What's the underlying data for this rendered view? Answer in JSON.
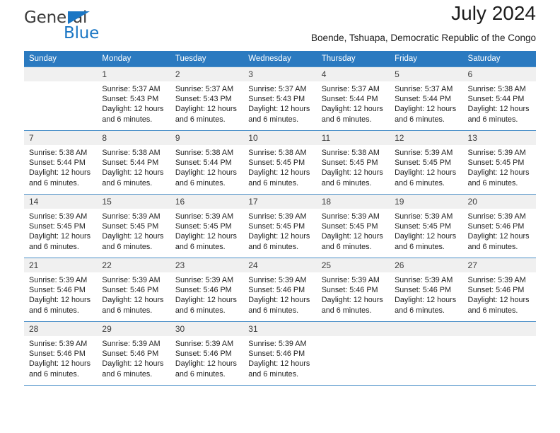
{
  "logo": {
    "primary_text": "General",
    "secondary_text": "Blue",
    "triangle_color": "#1a76c4",
    "primary_color": "#3b3b3b",
    "secondary_color": "#1a76c4"
  },
  "header": {
    "title": "July 2024",
    "subtitle": "Boende, Tshuapa, Democratic Republic of the Congo",
    "header_background": "#2b7ac0",
    "daynum_background": "#f0f0f0"
  },
  "weekday_headers": [
    "Sunday",
    "Monday",
    "Tuesday",
    "Wednesday",
    "Thursday",
    "Friday",
    "Saturday"
  ],
  "labels": {
    "sunrise_prefix": "Sunrise:",
    "sunset_prefix": "Sunset:",
    "daylight_prefix": "Daylight:"
  },
  "weeks": [
    [
      {
        "day": "",
        "empty": true
      },
      {
        "day": "1",
        "sunrise": "Sunrise: 5:37 AM",
        "sunset": "Sunset: 5:43 PM",
        "daylight_line1": "Daylight: 12 hours",
        "daylight_line2": "and 6 minutes."
      },
      {
        "day": "2",
        "sunrise": "Sunrise: 5:37 AM",
        "sunset": "Sunset: 5:43 PM",
        "daylight_line1": "Daylight: 12 hours",
        "daylight_line2": "and 6 minutes."
      },
      {
        "day": "3",
        "sunrise": "Sunrise: 5:37 AM",
        "sunset": "Sunset: 5:43 PM",
        "daylight_line1": "Daylight: 12 hours",
        "daylight_line2": "and 6 minutes."
      },
      {
        "day": "4",
        "sunrise": "Sunrise: 5:37 AM",
        "sunset": "Sunset: 5:44 PM",
        "daylight_line1": "Daylight: 12 hours",
        "daylight_line2": "and 6 minutes."
      },
      {
        "day": "5",
        "sunrise": "Sunrise: 5:37 AM",
        "sunset": "Sunset: 5:44 PM",
        "daylight_line1": "Daylight: 12 hours",
        "daylight_line2": "and 6 minutes."
      },
      {
        "day": "6",
        "sunrise": "Sunrise: 5:38 AM",
        "sunset": "Sunset: 5:44 PM",
        "daylight_line1": "Daylight: 12 hours",
        "daylight_line2": "and 6 minutes."
      }
    ],
    [
      {
        "day": "7",
        "sunrise": "Sunrise: 5:38 AM",
        "sunset": "Sunset: 5:44 PM",
        "daylight_line1": "Daylight: 12 hours",
        "daylight_line2": "and 6 minutes."
      },
      {
        "day": "8",
        "sunrise": "Sunrise: 5:38 AM",
        "sunset": "Sunset: 5:44 PM",
        "daylight_line1": "Daylight: 12 hours",
        "daylight_line2": "and 6 minutes."
      },
      {
        "day": "9",
        "sunrise": "Sunrise: 5:38 AM",
        "sunset": "Sunset: 5:44 PM",
        "daylight_line1": "Daylight: 12 hours",
        "daylight_line2": "and 6 minutes."
      },
      {
        "day": "10",
        "sunrise": "Sunrise: 5:38 AM",
        "sunset": "Sunset: 5:45 PM",
        "daylight_line1": "Daylight: 12 hours",
        "daylight_line2": "and 6 minutes."
      },
      {
        "day": "11",
        "sunrise": "Sunrise: 5:38 AM",
        "sunset": "Sunset: 5:45 PM",
        "daylight_line1": "Daylight: 12 hours",
        "daylight_line2": "and 6 minutes."
      },
      {
        "day": "12",
        "sunrise": "Sunrise: 5:39 AM",
        "sunset": "Sunset: 5:45 PM",
        "daylight_line1": "Daylight: 12 hours",
        "daylight_line2": "and 6 minutes."
      },
      {
        "day": "13",
        "sunrise": "Sunrise: 5:39 AM",
        "sunset": "Sunset: 5:45 PM",
        "daylight_line1": "Daylight: 12 hours",
        "daylight_line2": "and 6 minutes."
      }
    ],
    [
      {
        "day": "14",
        "sunrise": "Sunrise: 5:39 AM",
        "sunset": "Sunset: 5:45 PM",
        "daylight_line1": "Daylight: 12 hours",
        "daylight_line2": "and 6 minutes."
      },
      {
        "day": "15",
        "sunrise": "Sunrise: 5:39 AM",
        "sunset": "Sunset: 5:45 PM",
        "daylight_line1": "Daylight: 12 hours",
        "daylight_line2": "and 6 minutes."
      },
      {
        "day": "16",
        "sunrise": "Sunrise: 5:39 AM",
        "sunset": "Sunset: 5:45 PM",
        "daylight_line1": "Daylight: 12 hours",
        "daylight_line2": "and 6 minutes."
      },
      {
        "day": "17",
        "sunrise": "Sunrise: 5:39 AM",
        "sunset": "Sunset: 5:45 PM",
        "daylight_line1": "Daylight: 12 hours",
        "daylight_line2": "and 6 minutes."
      },
      {
        "day": "18",
        "sunrise": "Sunrise: 5:39 AM",
        "sunset": "Sunset: 5:45 PM",
        "daylight_line1": "Daylight: 12 hours",
        "daylight_line2": "and 6 minutes."
      },
      {
        "day": "19",
        "sunrise": "Sunrise: 5:39 AM",
        "sunset": "Sunset: 5:45 PM",
        "daylight_line1": "Daylight: 12 hours",
        "daylight_line2": "and 6 minutes."
      },
      {
        "day": "20",
        "sunrise": "Sunrise: 5:39 AM",
        "sunset": "Sunset: 5:46 PM",
        "daylight_line1": "Daylight: 12 hours",
        "daylight_line2": "and 6 minutes."
      }
    ],
    [
      {
        "day": "21",
        "sunrise": "Sunrise: 5:39 AM",
        "sunset": "Sunset: 5:46 PM",
        "daylight_line1": "Daylight: 12 hours",
        "daylight_line2": "and 6 minutes."
      },
      {
        "day": "22",
        "sunrise": "Sunrise: 5:39 AM",
        "sunset": "Sunset: 5:46 PM",
        "daylight_line1": "Daylight: 12 hours",
        "daylight_line2": "and 6 minutes."
      },
      {
        "day": "23",
        "sunrise": "Sunrise: 5:39 AM",
        "sunset": "Sunset: 5:46 PM",
        "daylight_line1": "Daylight: 12 hours",
        "daylight_line2": "and 6 minutes."
      },
      {
        "day": "24",
        "sunrise": "Sunrise: 5:39 AM",
        "sunset": "Sunset: 5:46 PM",
        "daylight_line1": "Daylight: 12 hours",
        "daylight_line2": "and 6 minutes."
      },
      {
        "day": "25",
        "sunrise": "Sunrise: 5:39 AM",
        "sunset": "Sunset: 5:46 PM",
        "daylight_line1": "Daylight: 12 hours",
        "daylight_line2": "and 6 minutes."
      },
      {
        "day": "26",
        "sunrise": "Sunrise: 5:39 AM",
        "sunset": "Sunset: 5:46 PM",
        "daylight_line1": "Daylight: 12 hours",
        "daylight_line2": "and 6 minutes."
      },
      {
        "day": "27",
        "sunrise": "Sunrise: 5:39 AM",
        "sunset": "Sunset: 5:46 PM",
        "daylight_line1": "Daylight: 12 hours",
        "daylight_line2": "and 6 minutes."
      }
    ],
    [
      {
        "day": "28",
        "sunrise": "Sunrise: 5:39 AM",
        "sunset": "Sunset: 5:46 PM",
        "daylight_line1": "Daylight: 12 hours",
        "daylight_line2": "and 6 minutes."
      },
      {
        "day": "29",
        "sunrise": "Sunrise: 5:39 AM",
        "sunset": "Sunset: 5:46 PM",
        "daylight_line1": "Daylight: 12 hours",
        "daylight_line2": "and 6 minutes."
      },
      {
        "day": "30",
        "sunrise": "Sunrise: 5:39 AM",
        "sunset": "Sunset: 5:46 PM",
        "daylight_line1": "Daylight: 12 hours",
        "daylight_line2": "and 6 minutes."
      },
      {
        "day": "31",
        "sunrise": "Sunrise: 5:39 AM",
        "sunset": "Sunset: 5:46 PM",
        "daylight_line1": "Daylight: 12 hours",
        "daylight_line2": "and 6 minutes."
      },
      {
        "day": "",
        "empty": true
      },
      {
        "day": "",
        "empty": true
      },
      {
        "day": "",
        "empty": true
      }
    ]
  ]
}
